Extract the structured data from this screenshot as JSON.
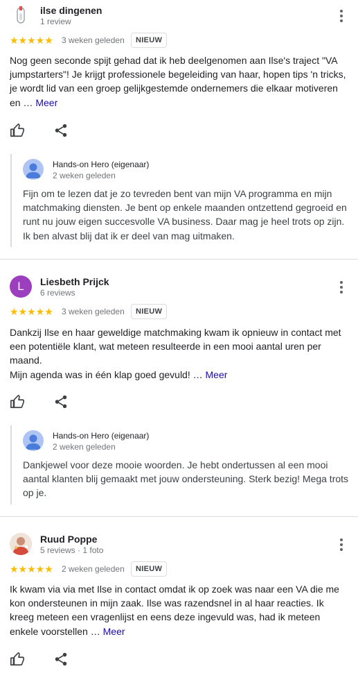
{
  "reviews": [
    {
      "author": "ilse dingenen",
      "meta": "1 review",
      "avatar": "document-icon",
      "stars": "★★★★★",
      "date": "3 weken geleden",
      "badge": "NIEUW",
      "text": "Nog geen seconde spijt gehad dat ik heb deelgenomen aan Ilse's traject \"VA jumpstarters\"! Je krijgt professionele begeleiding van haar, hopen tips 'n tricks, je wordt lid van een groep gelijkgestemde ondernemers die elkaar motiveren en … ",
      "more_link": "Meer",
      "reply": {
        "owner": "Hands-on Hero (eigenaar)",
        "date": "2 weken geleden",
        "text": "Fijn om te lezen dat je zo tevreden bent van mijn VA programma en mijn matchmaking diensten. Je bent op enkele maanden ontzettend gegroeid en runt nu jouw eigen succesvolle VA business. Daar mag je heel trots op zijn. Ik ben alvast blij dat ik er deel van mag uitmaken."
      }
    },
    {
      "author": "Liesbeth Prijck",
      "meta": "6 reviews",
      "avatar_letter": "L",
      "stars": "★★★★★",
      "date": "3 weken geleden",
      "badge": "NIEUW",
      "text_line1": "Dankzij Ilse en haar geweldige matchmaking kwam ik opnieuw in contact met een potentiële klant, wat meteen resulteerde in een mooi aantal uren per maand.",
      "text_line2": "Mijn agenda was in één klap goed gevuld! … ",
      "more_link": "Meer",
      "reply": {
        "owner": "Hands-on Hero (eigenaar)",
        "date": "2 weken geleden",
        "text": "Dankjewel voor deze mooie woorden. Je hebt ondertussen al een mooi aantal klanten blij gemaakt met jouw ondersteuning. Sterk bezig! Mega trots op je."
      }
    },
    {
      "author": "Ruud Poppe",
      "meta": "5 reviews · 1 foto",
      "avatar": "profile-photo",
      "stars": "★★★★★",
      "date": "2 weken geleden",
      "badge": "NIEUW",
      "text": "Ik kwam via via met Ilse in contact omdat ik op zoek was naar een VA die me kon ondersteunen in mijn zaak. Ilse was razendsnel in al haar reacties. Ik kreeg meteen een vragenlijst en eens deze ingevuld was, had ik meteen enkele voorstellen … ",
      "more_link": "Meer"
    }
  ],
  "colors": {
    "star": "#fbbc04",
    "link": "#1a0dab",
    "avatar_l": "#9c3fbf"
  }
}
